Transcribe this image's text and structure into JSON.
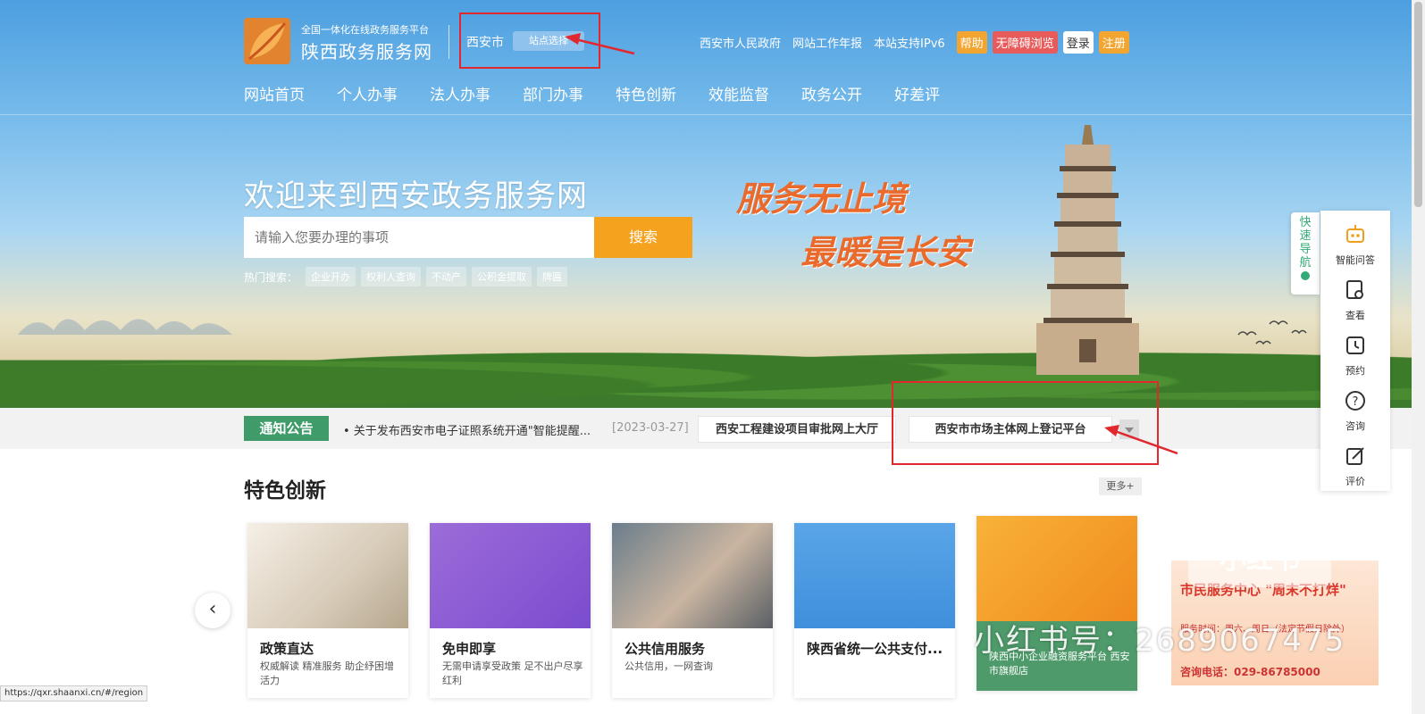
{
  "header": {
    "platform_sub": "全国一体化在线政务服务平台",
    "site_title": "陕西政务服务网",
    "city": "西安市",
    "site_select": "站点选择",
    "top_links": [
      "西安市人民政府",
      "网站工作年报",
      "本站支持IPv6"
    ],
    "help": "帮助",
    "accessibility": "无障碍浏览",
    "login": "登录",
    "register": "注册"
  },
  "nav": [
    "网站首页",
    "个人办事",
    "法人办事",
    "部门办事",
    "特色创新",
    "效能监督",
    "政务公开",
    "好差评"
  ],
  "hero": {
    "welcome": "欢迎来到西安政务服务网",
    "search_placeholder": "请输入您要办理的事项",
    "search_button": "搜索",
    "hot_label": "热门搜索：",
    "hot_tags": [
      "企业开办",
      "权利人查询",
      "不动产",
      "公积金提取",
      "牌匾"
    ],
    "slogan_1": "服务无止境",
    "slogan_2": "最暖是长安"
  },
  "notice": {
    "tag": "通知公告",
    "text": "• 关于发布西安市电子证照系统开通\"智能提醒...",
    "date": "[2023-03-27]",
    "quick_link_1": "西安工程建设项目审批网上大厅",
    "quick_link_2": "西安市市场主体网上登记平台"
  },
  "features": {
    "title": "特色创新",
    "more": "更多+",
    "cards": [
      {
        "title": "政策直达",
        "desc": "权威解读 精准服务 助企纾困增活力"
      },
      {
        "title": "免申即享",
        "desc": "无需申请享受政策 足不出户尽享红利"
      },
      {
        "title": "公共信用服务",
        "desc": "公共信用，一网查询"
      },
      {
        "title": "陕西省统一公共支付...",
        "desc": ""
      },
      {
        "title": "",
        "desc": "陕西中小企业融资服务平台 西安市旗舰店"
      }
    ],
    "promo": {
      "line1": "市民服务中心 \"周末不打烊\"",
      "line2": "服务时间：周六、周日（法定节假日除外）",
      "line3": "咨询电话：029-86785000"
    }
  },
  "sidebar": {
    "quick_nav": "快速导航",
    "items": [
      "智能问答",
      "查看",
      "预约",
      "咨询",
      "评价"
    ]
  },
  "watermark": {
    "text": "小红书号：2689067475",
    "logo": "小红书"
  },
  "status_url": "https://qxr.shaanxi.cn/#/region",
  "colors": {
    "accent_orange": "#f5a21f",
    "notice_green": "#3f9b6a",
    "highlight_red": "#e0282e",
    "slogan_orange": "#ea6a2c"
  }
}
